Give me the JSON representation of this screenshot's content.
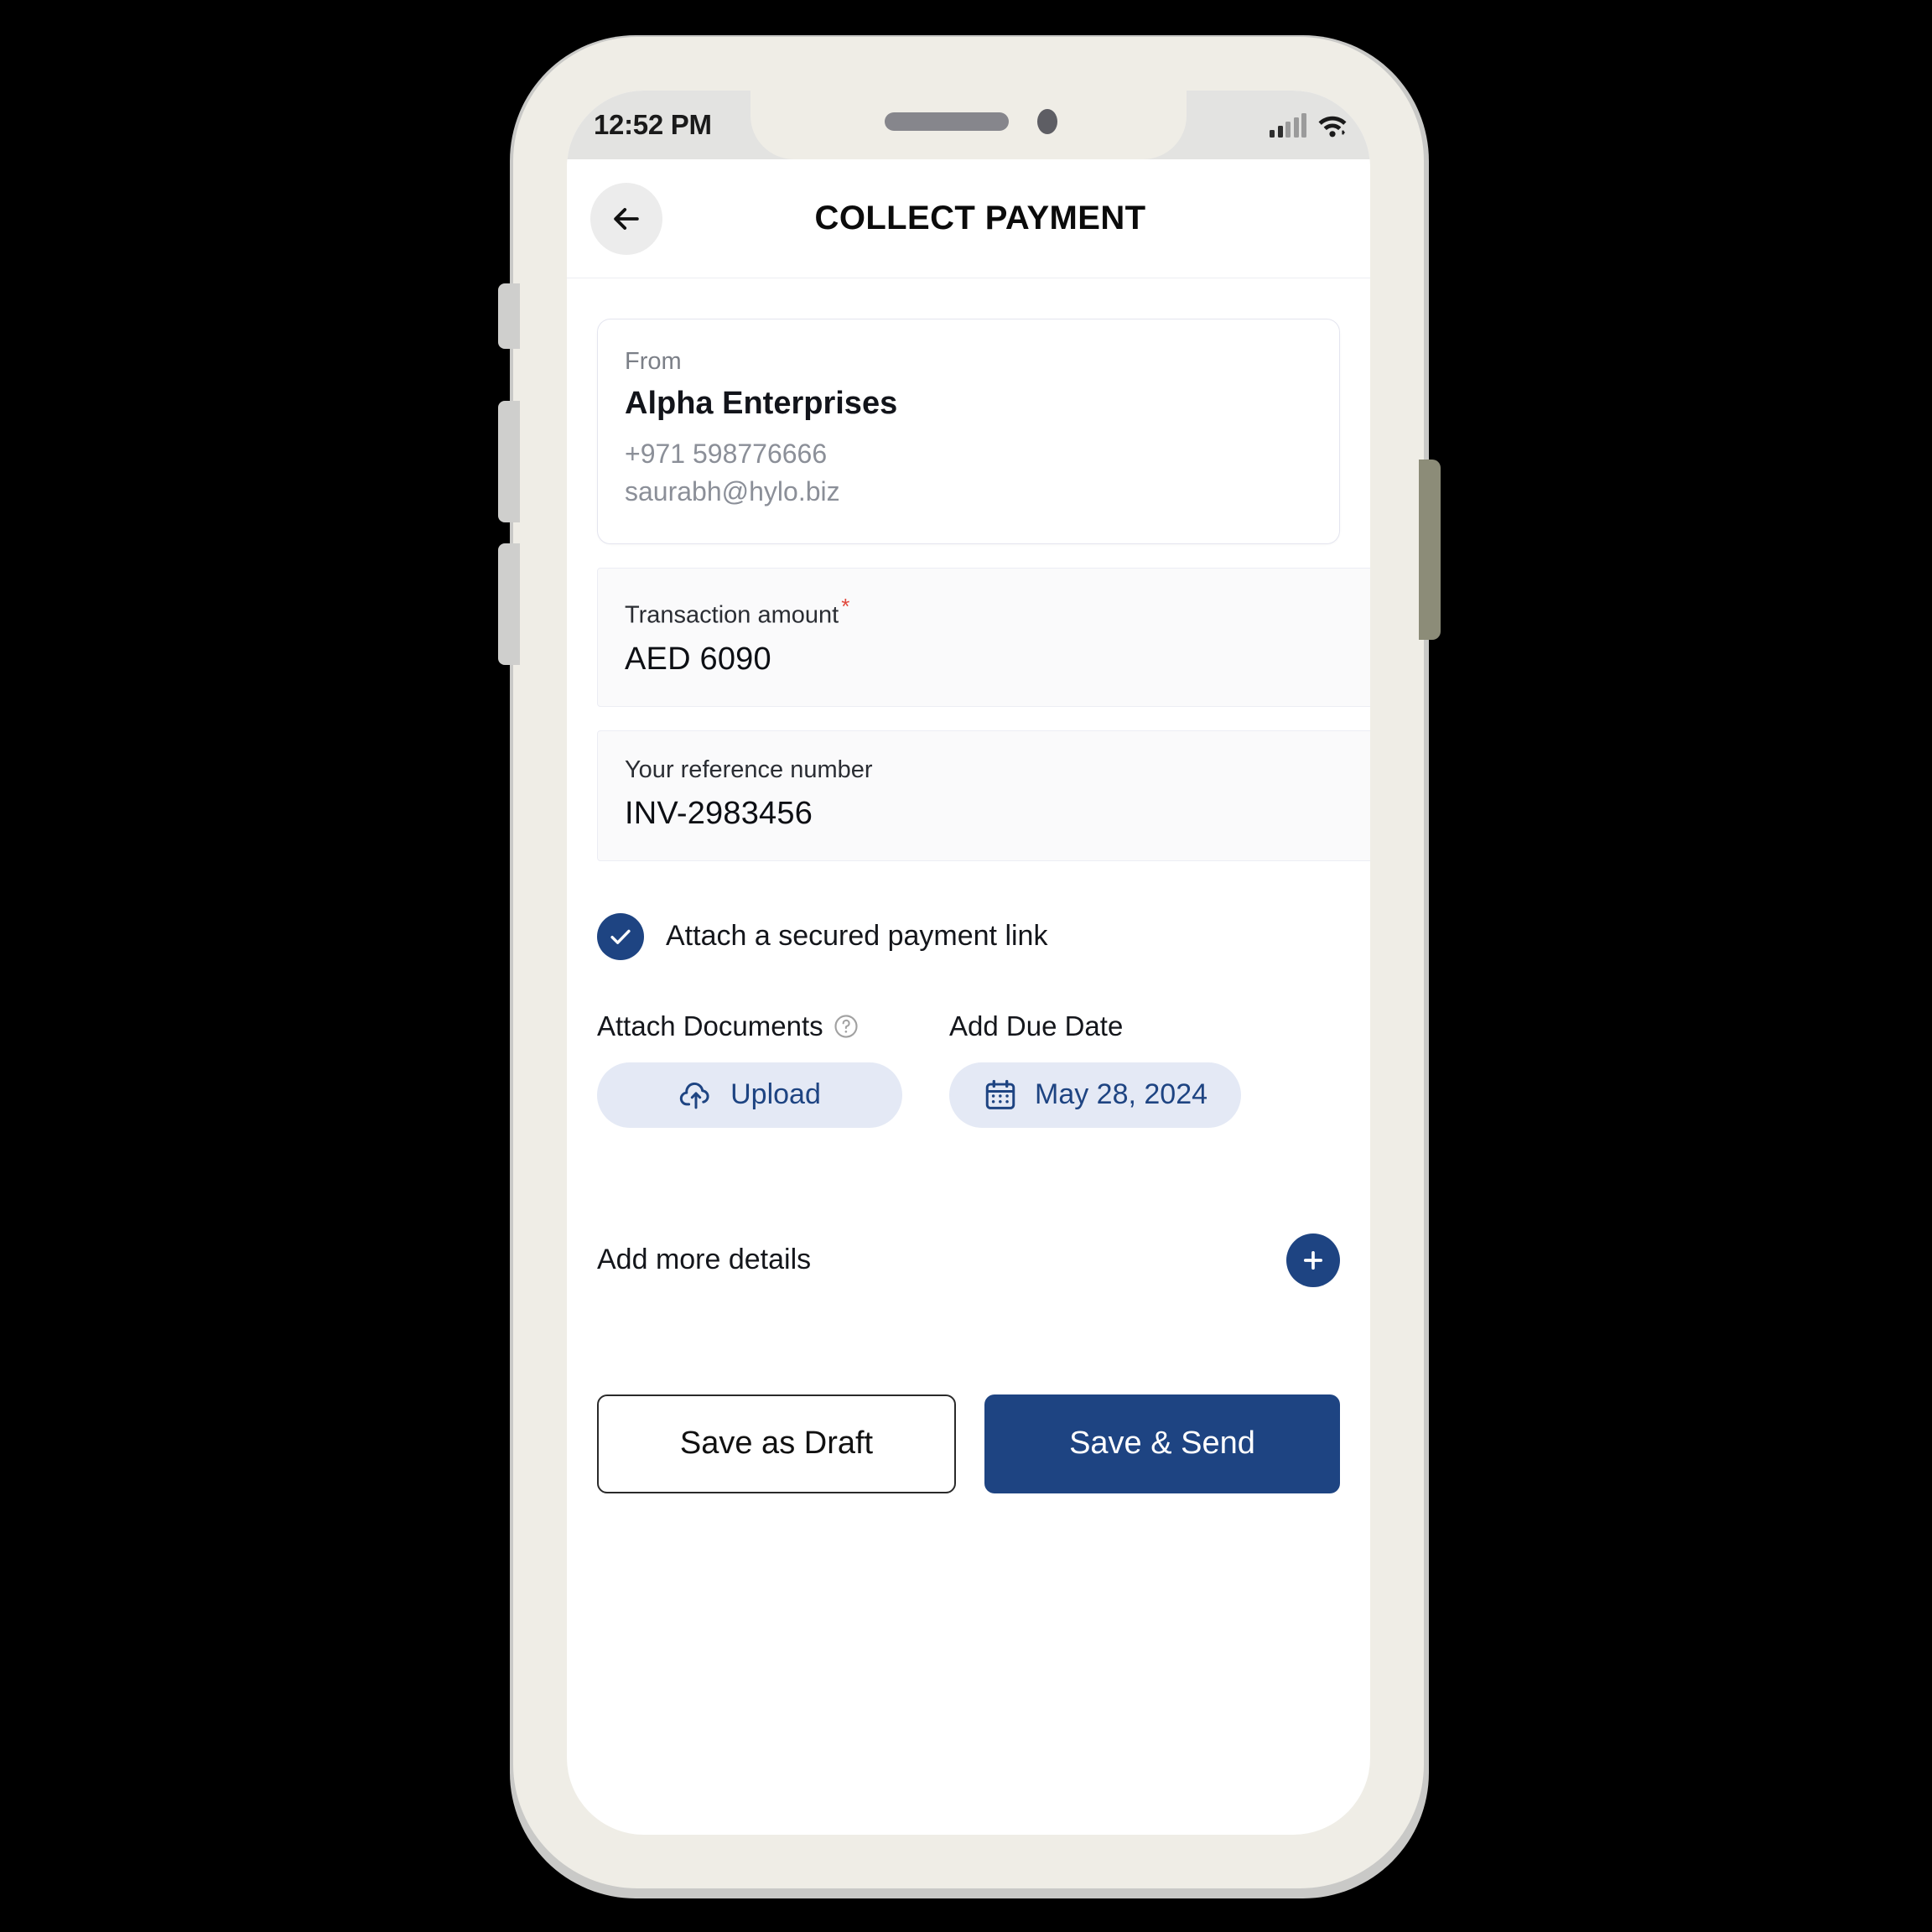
{
  "status_bar": {
    "time": "12:52 PM",
    "signal_icon": "signal-bars-icon",
    "wifi_icon": "wifi-icon"
  },
  "header": {
    "back_icon": "back-arrow-icon",
    "title": "COLLECT PAYMENT"
  },
  "from_card": {
    "label": "From",
    "name": "Alpha Enterprises",
    "phone": "+971 598776666",
    "email": "saurabh@hylo.biz"
  },
  "fields": [
    {
      "label": "Transaction amount",
      "required": true,
      "required_marker": "*",
      "value": "AED  6090"
    },
    {
      "label": "Your reference number",
      "required": false,
      "required_marker": "",
      "value": "INV-2983456"
    }
  ],
  "secure_link": {
    "checked": true,
    "check_icon": "checkmark-icon",
    "label": "Attach a secured payment link"
  },
  "attach_documents": {
    "heading": "Attach Documents",
    "help_icon": "help-circle-icon",
    "upload_icon": "cloud-upload-icon",
    "upload_label": "Upload"
  },
  "due_date": {
    "heading": "Add Due Date",
    "calendar_icon": "calendar-icon",
    "value": "May 28, 2024"
  },
  "add_more": {
    "label": "Add more details",
    "plus_icon": "plus-icon"
  },
  "actions": {
    "draft_label": "Save as Draft",
    "send_label": "Save & Send"
  },
  "colors": {
    "brand_navy": "#1e4482",
    "pill_bg": "#e4e9f5",
    "required_red": "#e0483c",
    "field_bg": "#fafafb",
    "phone_body": "#efedE6"
  }
}
